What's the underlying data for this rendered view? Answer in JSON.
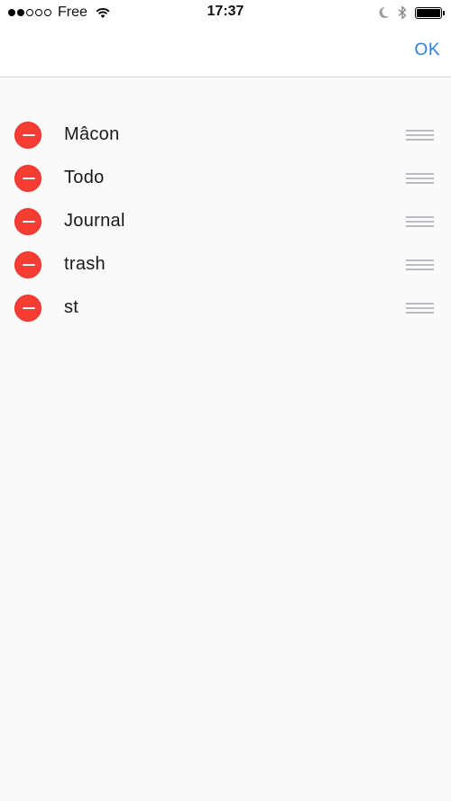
{
  "status_bar": {
    "carrier": "Free",
    "time": "17:37",
    "signal_bars_filled": 2,
    "signal_bars_total": 5,
    "battery_level": 1.0
  },
  "nav": {
    "ok_label": "OK",
    "ok_color": "#2f7fd3"
  },
  "list": {
    "items": [
      {
        "label": "Mâcon"
      },
      {
        "label": "Todo"
      },
      {
        "label": "Journal"
      },
      {
        "label": "trash"
      },
      {
        "label": "st"
      }
    ]
  },
  "colors": {
    "delete": "#f63c33",
    "background": "#fafafa",
    "reorder_handle": "#bcbcc2"
  },
  "icons": {
    "delete": "minus-circle-icon",
    "reorder": "reorder-handle-icon",
    "wifi": "wifi-icon",
    "moon": "moon-icon",
    "bluetooth": "bluetooth-icon",
    "battery": "battery-icon"
  }
}
